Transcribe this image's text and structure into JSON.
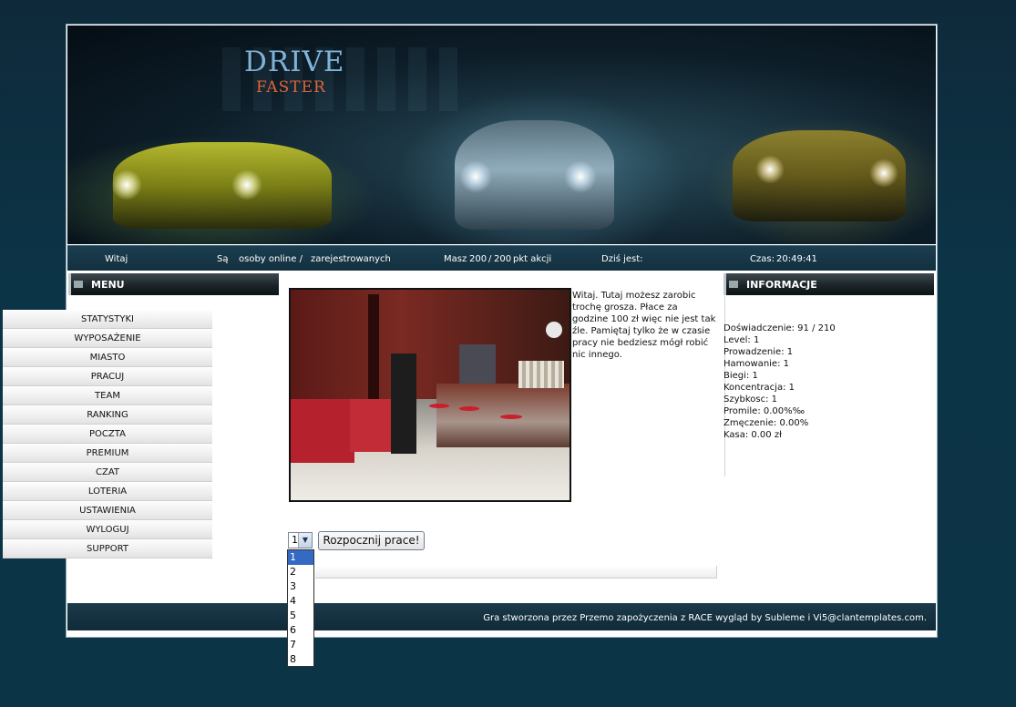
{
  "logo": {
    "line1": "DRIVE",
    "line2": "FASTER"
  },
  "statusbar": {
    "welcome": "Witaj",
    "online_prefix": "Są",
    "online_mid": "osoby online /",
    "registered": "zarejestrowanych",
    "actions_prefix": "Masz",
    "actions_current": "200",
    "actions_sep": "/",
    "actions_max": "200",
    "actions_suffix": "pkt akcji",
    "today_label": "Dziś jest:",
    "time_label": "Czas:",
    "time_value": "20:49:41"
  },
  "menu": {
    "title": "MENU",
    "items": [
      "STATYSTYKI",
      "WYPOSAŻENIE",
      "MIASTO",
      "PRACUJ",
      "TEAM",
      "RANKING",
      "POCZTA",
      "PREMIUM",
      "CZAT",
      "LOTERIA",
      "USTAWIENIA",
      "WYLOGUJ",
      "SUPPORT"
    ]
  },
  "work": {
    "description": "Witaj. Tutaj możesz zarobic trochę grosza. Płace za godzine 100 zł więc nie jest tak źle. Pamiętaj tylko że w czasie pracy nie bedziesz mógł robić nic innego.",
    "hours_selected": "1",
    "hours_options": [
      "1",
      "2",
      "3",
      "4",
      "5",
      "6",
      "7",
      "8"
    ],
    "start_button": "Rozpocznij prace!"
  },
  "info": {
    "title": "INFORMACJE",
    "lines": [
      "Doświadczenie: 91 / 210",
      "Level: 1",
      "Prowadzenie: 1",
      "Hamowanie: 1",
      "Biegi: 1",
      "Koncentracja: 1",
      "Szybkosc: 1",
      "Promile: 0.00%‰",
      "Zmęczenie: 0.00%",
      "Kasa: 0.00 zł"
    ]
  },
  "footer": {
    "credit": "Gra stworzona przez Przemo zapożyczenia z RACE wygląd by Subleme i Vi5@clantemplates.com."
  }
}
